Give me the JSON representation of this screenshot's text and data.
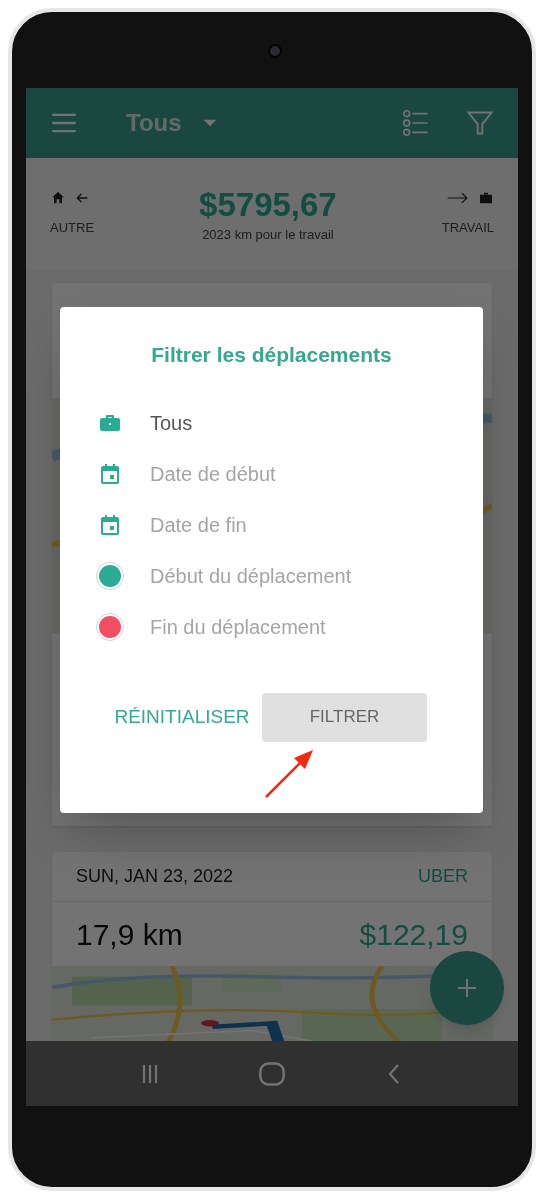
{
  "app_bar": {
    "title": "Tous"
  },
  "summary": {
    "left_label": "AUTRE",
    "amount": "$5795,67",
    "subtitle": "2023 km pour le travail",
    "right_label": "TRAVAIL"
  },
  "trips": [
    {
      "kind": "hidden"
    },
    {
      "kind": "full",
      "date": "SUN, JAN 23, 2022",
      "service": "UBER",
      "distance": "17,9 km",
      "amount": "$122,19"
    }
  ],
  "dialog": {
    "title": "Filtrer les déplacements",
    "options": [
      {
        "kind": "category",
        "label": "Tous",
        "filled": true
      },
      {
        "kind": "date",
        "label": "Date de début",
        "filled": false
      },
      {
        "kind": "date",
        "label": "Date de fin",
        "filled": false
      },
      {
        "kind": "place",
        "label": "Début du déplacement",
        "filled": false,
        "color": "#2bab92"
      },
      {
        "kind": "place",
        "label": "Fin du déplacement",
        "filled": false,
        "color": "#f24e62"
      }
    ],
    "buttons": [
      {
        "kind": "text",
        "label": "RÉINITIALISER"
      },
      {
        "kind": "raised",
        "label": "FILTRER"
      }
    ]
  }
}
